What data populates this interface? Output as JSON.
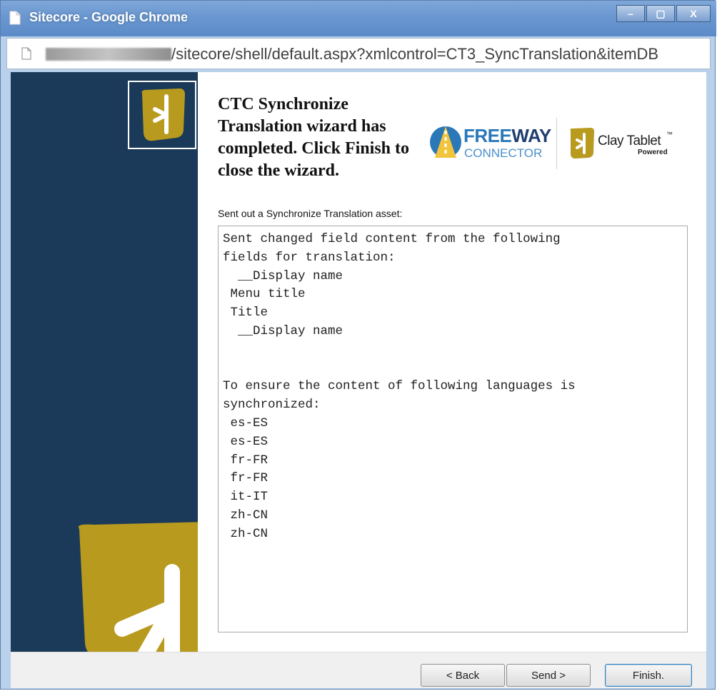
{
  "window": {
    "title": "Sitecore - Google Chrome",
    "controls": {
      "minimize": "–",
      "maximize": "▢",
      "close": "X"
    }
  },
  "address_bar": {
    "url": "/sitecore/shell/default.aspx?xmlcontrol=CT3_SyncTranslation&itemDB"
  },
  "wizard": {
    "heading": "CTC Synchronize Translation wizard has completed. Click Finish to close the wizard.",
    "logos": {
      "freeway_free": "FREE",
      "freeway_way": "WAY",
      "connector": "CONNECTOR",
      "clay_tablet": "Clay Tablet",
      "clay_tm": "™",
      "powered": "Powered"
    },
    "result_label": "Sent out a Synchronize Translation asset:",
    "result_text": "Sent changed field content from the following\nfields for translation:\n  __Display name\n Menu title\n Title\n  __Display name\n\n\nTo ensure the content of following languages is\nsynchronized:\n es-ES\n es-ES\n fr-FR\n fr-FR\n it-IT\n zh-CN\n zh-CN"
  },
  "buttons": {
    "back": "< Back",
    "send": "Send >",
    "finish": "Finish."
  },
  "colors": {
    "side_panel": "#1b3a5a",
    "logo_gold": "#b89a1e",
    "title_bar": "#6a97d0",
    "freeway_blue": "#2a78b8"
  }
}
